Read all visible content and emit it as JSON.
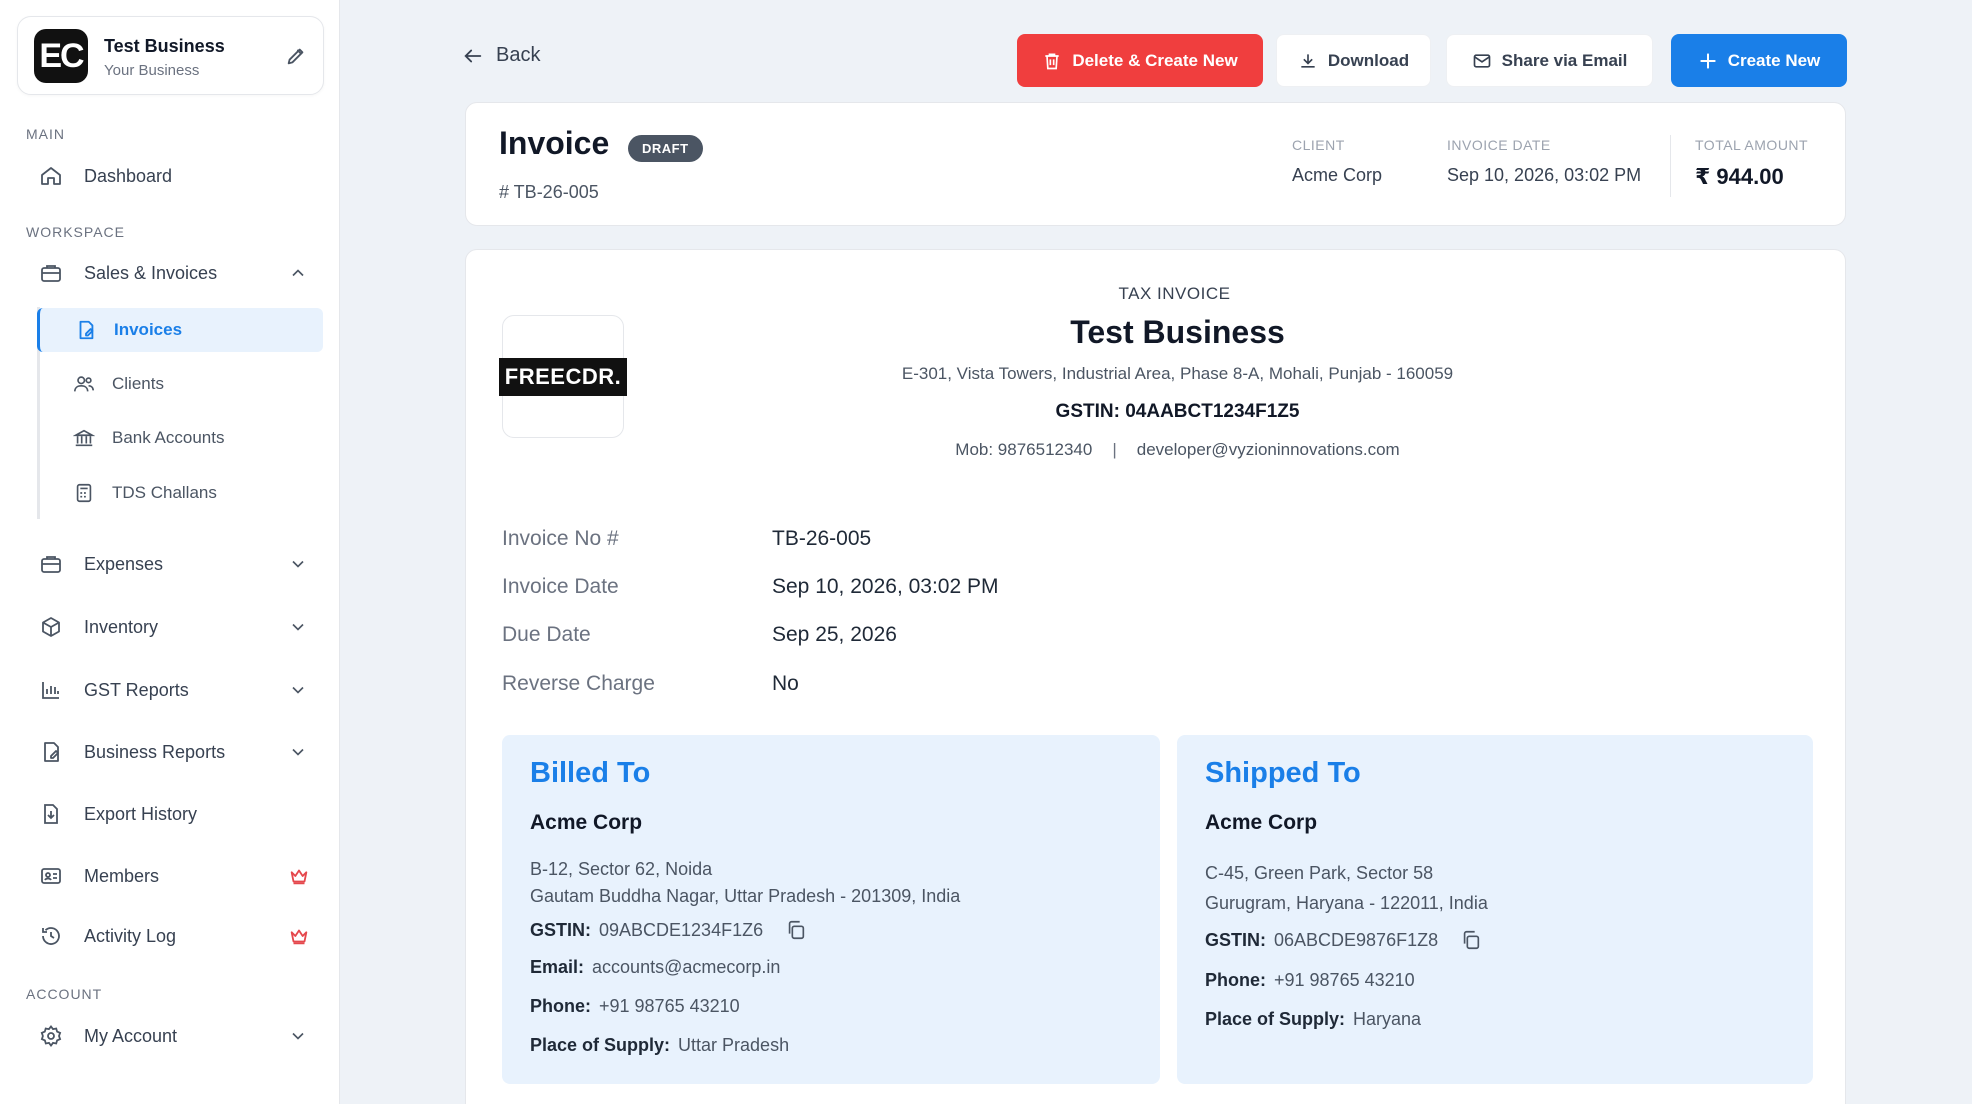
{
  "sidebar": {
    "business": {
      "logo_text": "EC",
      "name": "Test Business",
      "subtitle": "Your Business"
    },
    "sections": {
      "main": "MAIN",
      "workspace": "WORKSPACE",
      "account": "ACCOUNT"
    },
    "items": {
      "dashboard": "Dashboard",
      "sales": "Sales & Invoices",
      "invoices": "Invoices",
      "clients": "Clients",
      "bank_accounts": "Bank Accounts",
      "tds_challans": "TDS Challans",
      "expenses": "Expenses",
      "inventory": "Inventory",
      "gst_reports": "GST Reports",
      "business_reports": "Business Reports",
      "export_history": "Export History",
      "members": "Members",
      "activity_log": "Activity Log",
      "my_account": "My Account"
    }
  },
  "toolbar": {
    "back": "Back",
    "delete_create": "Delete & Create New",
    "download": "Download",
    "share_email": "Share via Email",
    "create_new": "Create New"
  },
  "summary": {
    "title": "Invoice",
    "status": "DRAFT",
    "number": "# TB-26-005",
    "client_label": "CLIENT",
    "client_value": "Acme Corp",
    "date_label": "INVOICE DATE",
    "date_value": "Sep 10, 2026, 03:02 PM",
    "total_label": "TOTAL AMOUNT",
    "total_value": "₹ 944.00"
  },
  "document": {
    "logo_text": "FREECDR.",
    "heading": "TAX INVOICE",
    "business_name": "Test Business",
    "address": "E-301, Vista Towers, Industrial Area, Phase 8-A, Mohali, Punjab - 160059",
    "gstin": "GSTIN: 04AABCT1234F1Z5",
    "mobile": "Mob: 9876512340",
    "separator": "|",
    "email": "developer@vyzioninnovations.com",
    "details": [
      {
        "label": "Invoice No #",
        "value": "TB-26-005"
      },
      {
        "label": "Invoice Date",
        "value": "Sep 10, 2026, 03:02 PM"
      },
      {
        "label": "Due Date",
        "value": "Sep 25, 2026"
      },
      {
        "label": "Reverse Charge",
        "value": "No"
      }
    ],
    "billed": {
      "title": "Billed To",
      "name": "Acme Corp",
      "address1": "B-12, Sector 62, Noida",
      "address2": "Gautam Buddha Nagar, Uttar Pradesh - 201309, India",
      "gstin_label": "GSTIN:",
      "gstin": "09ABCDE1234F1Z6",
      "email_label": "Email:",
      "email": "accounts@acmecorp.in",
      "phone_label": "Phone:",
      "phone": "+91 98765 43210",
      "supply_label": "Place of Supply:",
      "supply": "Uttar Pradesh"
    },
    "shipped": {
      "title": "Shipped To",
      "name": "Acme Corp",
      "address1": "C-45, Green Park, Sector 58",
      "address2": "Gurugram, Haryana - 122011, India",
      "gstin_label": "GSTIN:",
      "gstin": "06ABCDE9876F1Z8",
      "phone_label": "Phone:",
      "phone": "+91 98765 43210",
      "supply_label": "Place of Supply:",
      "supply": "Haryana"
    }
  },
  "colors": {
    "accent": "#1a7fe8",
    "danger": "#f03e3e",
    "draft": "#4b5563",
    "crown": "#e5484d"
  }
}
